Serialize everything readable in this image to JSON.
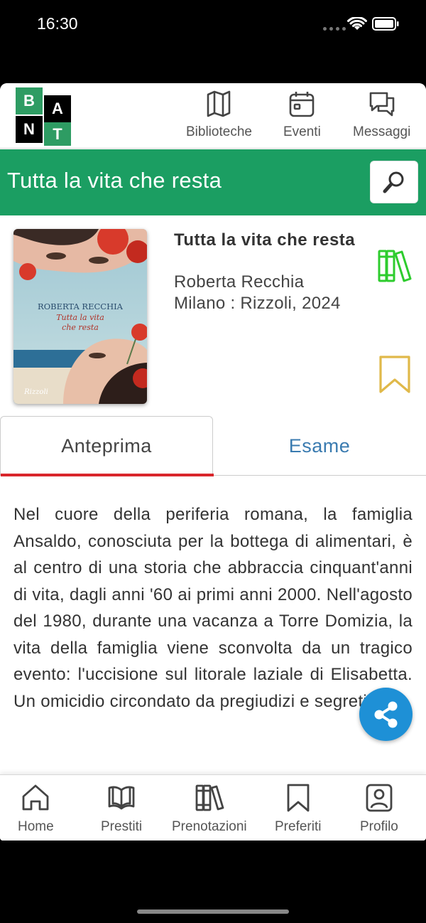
{
  "status": {
    "time": "16:30"
  },
  "logo": {
    "letters": [
      "B",
      "A",
      "N",
      "T"
    ],
    "colors": {
      "green": "#2e9c63",
      "black": "#000000"
    }
  },
  "top_nav": [
    {
      "label": "Biblioteche",
      "icon": "map-icon"
    },
    {
      "label": "Eventi",
      "icon": "calendar-icon"
    },
    {
      "label": "Messaggi",
      "icon": "chat-icon"
    }
  ],
  "title_bar": {
    "title": "Tutta la vita che resta",
    "color": "#1b9e62"
  },
  "book": {
    "title": "Tutta la vita che resta",
    "author": "Roberta Recchia",
    "publication": "Milano : Rizzoli, 2024",
    "cover": {
      "author": "ROBERTA RECCHIA",
      "title_line1": "Tutta la vita",
      "title_line2": "che resta",
      "publisher": "Rizzoli"
    }
  },
  "tabs": [
    {
      "label": "Anteprima",
      "active": true
    },
    {
      "label": "Esame",
      "active": false
    }
  ],
  "description": "Nel cuore della periferia romana, la famiglia Ansaldo, conosciuta per la bottega di alimentari, è al centro di una storia che abbraccia cinquant'anni di vita, dagli anni '60 ai primi anni 2000. Nell'agosto del 1980, durante una vacanza a Torre Domizia, la vita della famiglia viene sconvolta da un tragico evento: l'uccisione sul litorale laziale di Elisabetta. Un omicidio circondato da pregiudizi e segreti, un",
  "bottom_nav": [
    {
      "label": "Home",
      "icon": "home-icon"
    },
    {
      "label": "Prestiti",
      "icon": "open-book-icon"
    },
    {
      "label": "Prenotazioni",
      "icon": "books-icon"
    },
    {
      "label": "Preferiti",
      "icon": "bookmark-icon"
    },
    {
      "label": "Profilo",
      "icon": "profile-icon"
    }
  ],
  "colors": {
    "accent_green": "#1b9e62",
    "tab_active_underline": "#d9262b",
    "tab_inactive_text": "#3a7bb0",
    "fab_blue": "#1e90d6",
    "books_icon_green": "#2ecc2e",
    "bookmark_yellow": "#e0b94a"
  }
}
